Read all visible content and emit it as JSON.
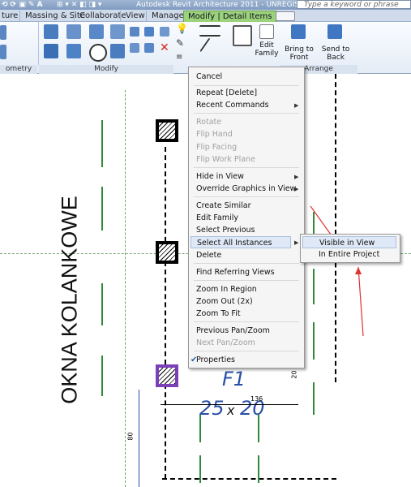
{
  "titlebar": {
    "left_text": "ture",
    "app_title": "Autodesk Revit Architecture 2011 - UNREGISTERED...",
    "search_placeholder": "Type a keyword or phrase"
  },
  "tabs": [
    {
      "label": "Massing & Site"
    },
    {
      "label": "Collaborate"
    },
    {
      "label": "View"
    },
    {
      "label": "Manage"
    },
    {
      "label": "Modify | Detail Items"
    }
  ],
  "ribbon": {
    "panels": {
      "geometry": "ometry",
      "modify": "Modify",
      "arrange": "Arrange"
    },
    "buttons": {
      "edit_family": "Edit Family",
      "bring_to_front": "Bring to Front",
      "send_to_back": "Send to Back"
    }
  },
  "context_menu": {
    "items": [
      {
        "label": "Cancel",
        "enabled": true
      },
      {
        "label": "Repeat [Delete]",
        "enabled": true
      },
      {
        "label": "Recent Commands",
        "enabled": true,
        "submenu": true
      },
      {
        "label": "Rotate",
        "enabled": false
      },
      {
        "label": "Flip Hand",
        "enabled": false
      },
      {
        "label": "Flip Facing",
        "enabled": false
      },
      {
        "label": "Flip Work Plane",
        "enabled": false
      },
      {
        "label": "Hide in View",
        "enabled": true,
        "submenu": true
      },
      {
        "label": "Override Graphics in View",
        "enabled": true,
        "submenu": true
      },
      {
        "label": "Create Similar",
        "enabled": true
      },
      {
        "label": "Edit Family",
        "enabled": true
      },
      {
        "label": "Select Previous",
        "enabled": true
      },
      {
        "label": "Select All Instances",
        "enabled": true,
        "submenu": true,
        "highlighted": true
      },
      {
        "label": "Delete",
        "enabled": true
      },
      {
        "label": "Find Referring Views",
        "enabled": true
      },
      {
        "label": "Zoom In Region",
        "enabled": true
      },
      {
        "label": "Zoom Out (2x)",
        "enabled": true
      },
      {
        "label": "Zoom To Fit",
        "enabled": true
      },
      {
        "label": "Previous Pan/Zoom",
        "enabled": true
      },
      {
        "label": "Next Pan/Zoom",
        "enabled": false
      },
      {
        "label": "Properties",
        "enabled": true,
        "checked": true
      }
    ],
    "submenu": [
      {
        "label": "Visible in View"
      },
      {
        "label": "In Entire Project"
      }
    ]
  },
  "drawing": {
    "vertical_label": "OKNA KOLANKOWE",
    "tag_name": "F1",
    "tag_size_left": "25",
    "tag_size_x": "x",
    "tag_size_right": "20",
    "dim_136": "136",
    "dim_20": "20",
    "dim_80": "80"
  },
  "colors": {
    "accent_tab": "#9bd27a",
    "tag_blue": "#2a4fa6",
    "selection_purple": "#7b3fb8",
    "annotation_red": "#e03030",
    "detail_green": "#2e8b3c"
  }
}
